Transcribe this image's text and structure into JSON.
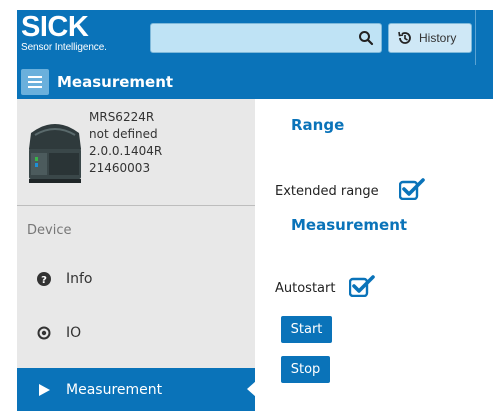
{
  "brand": {
    "name": "SICK",
    "tagline": "Sensor Intelligence."
  },
  "header": {
    "search_placeholder": "",
    "history_label": "History"
  },
  "page": {
    "title": "Measurement"
  },
  "device": {
    "model": "MRS6224R",
    "name": "not defined",
    "firmware": "2.0.0.1404R",
    "serial": "21460003"
  },
  "sidebar": {
    "section_label": "Device",
    "items": [
      {
        "label": "Info",
        "icon": "question-circle-icon"
      },
      {
        "label": "IO",
        "icon": "dot-circle-icon"
      },
      {
        "label": "Measurement",
        "icon": "play-icon",
        "active": true
      }
    ]
  },
  "main": {
    "range_heading": "Range",
    "extended_range_label": "Extended range",
    "extended_range_checked": true,
    "measurement_heading": "Measurement",
    "autostart_label": "Autostart",
    "autostart_checked": true,
    "start_label": "Start",
    "stop_label": "Stop"
  },
  "colors": {
    "brand_blue": "#0a73b9",
    "sidebar_bg": "#e8e8e8",
    "search_bg": "#bfe3f5"
  }
}
